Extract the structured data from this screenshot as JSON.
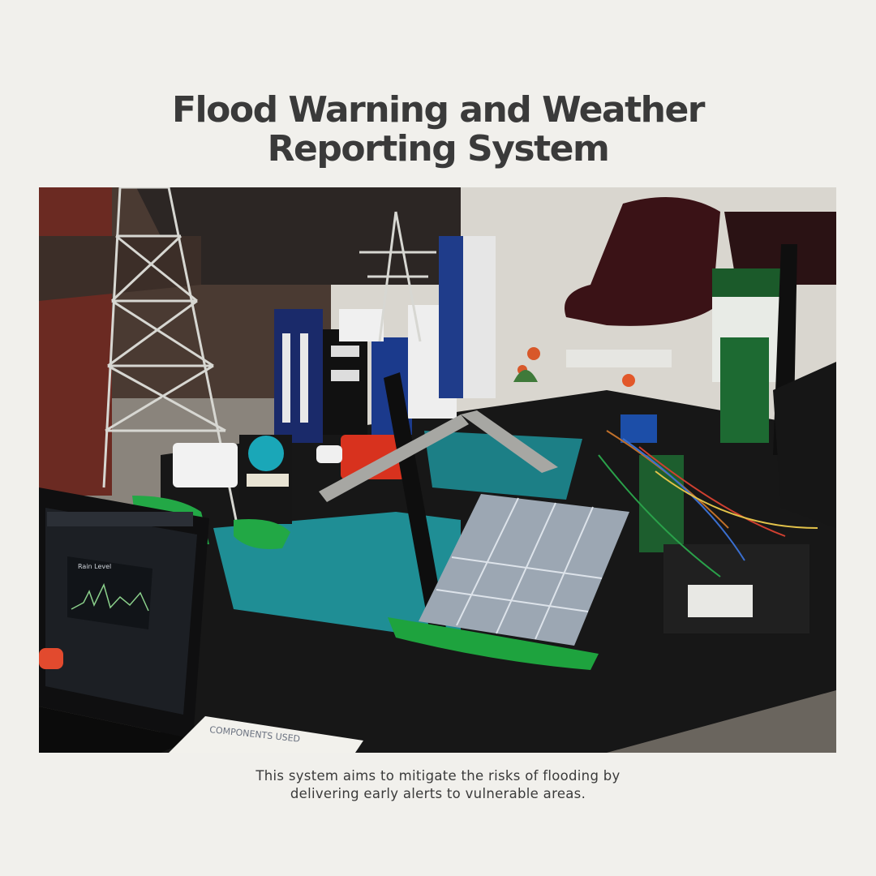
{
  "title": {
    "line1": "Flood Warning and Weather",
    "line2": "Reporting System"
  },
  "caption": "This system aims to mitigate the risks of flooding by delivering early alerts to vulnerable areas.",
  "photo": {
    "laptop_screen_label": "Rain Level",
    "paper_label": "COMPONENTS USED"
  }
}
